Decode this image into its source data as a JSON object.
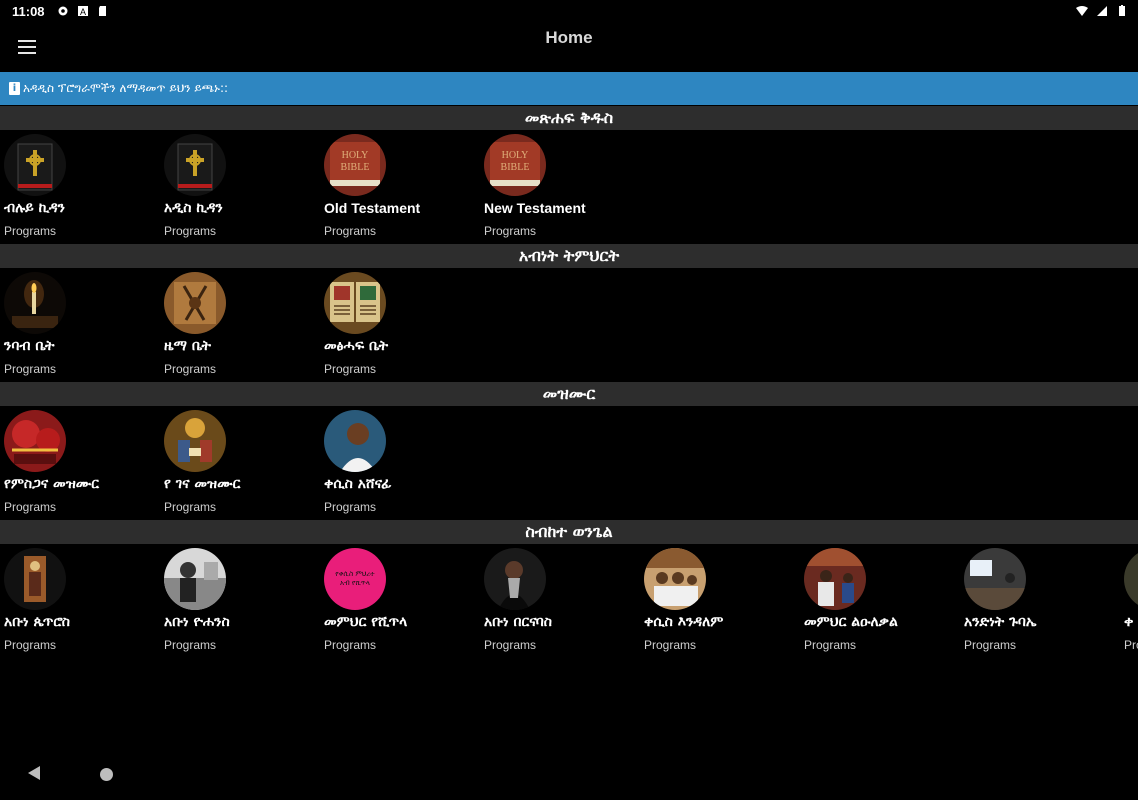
{
  "status_bar": {
    "time": "11:08",
    "left_icons": [
      "gear-icon",
      "a-icon",
      "sd-card-icon"
    ],
    "right_icons": [
      "wifi-icon",
      "signal-icon",
      "battery-icon"
    ]
  },
  "app_bar": {
    "title": "Home",
    "menu_icon": "hamburger-icon"
  },
  "banner": {
    "icon": "info-icon",
    "text": "አዳዲስ ፕሮግራሞችን ለማዳመጥ ይህን ይጫኑ::"
  },
  "sections": [
    {
      "title": "መጽሐፍ ቅዱስ",
      "items": [
        {
          "title": "ብሉይ ኪዳን",
          "subtitle": "Programs",
          "thumb": "cross-book"
        },
        {
          "title": "አዲስ ኪዳን",
          "subtitle": "Programs",
          "thumb": "cross-book"
        },
        {
          "title": "Old Testament",
          "subtitle": "Programs",
          "thumb": "holy-bible"
        },
        {
          "title": "New Testament",
          "subtitle": "Programs",
          "thumb": "holy-bible"
        }
      ]
    },
    {
      "title": "አብነት ትምህርት",
      "items": [
        {
          "title": "ንባብ ቤት",
          "subtitle": "Programs",
          "thumb": "candle"
        },
        {
          "title": "ዜማ ቤት",
          "subtitle": "Programs",
          "thumb": "drum"
        },
        {
          "title": "መፅሓፍ ቤት",
          "subtitle": "Programs",
          "thumb": "manuscript"
        }
      ]
    },
    {
      "title": "መዝሙር",
      "items": [
        {
          "title": "የምስጋና መዝሙር",
          "subtitle": "Programs",
          "thumb": "red-umbrella"
        },
        {
          "title": "የ ገና መዝሙር",
          "subtitle": "Programs",
          "thumb": "nativity"
        },
        {
          "title": "ቀሲስ አሸናፊ",
          "subtitle": "Programs",
          "thumb": "portrait"
        }
      ]
    },
    {
      "title": "ስብከተ ወንጌል",
      "items": [
        {
          "title": "አቡነ ጴጥሮስ",
          "subtitle": "Programs",
          "thumb": "icon-painting"
        },
        {
          "title": "አቡነ ዮሐንስ",
          "subtitle": "Programs",
          "thumb": "bw-photo"
        },
        {
          "title": "መምህር የሺጥላ",
          "subtitle": "Programs",
          "thumb": "pink-text",
          "thumb_text": "የቀሲስ ምህረተ አብ የሺጥላ"
        },
        {
          "title": "አቡነ በርናባስ",
          "subtitle": "Programs",
          "thumb": "bishop"
        },
        {
          "title": "ቀሲስ እንዳለም",
          "subtitle": "Programs",
          "thumb": "group-photo"
        },
        {
          "title": "መምህር ልዑለቃል",
          "subtitle": "Programs",
          "thumb": "preacher"
        },
        {
          "title": "አንድነት ጉባኤ",
          "subtitle": "Programs",
          "thumb": "hall"
        },
        {
          "title": "ቀ",
          "subtitle": "Programs",
          "thumb": "partial"
        }
      ]
    }
  ],
  "nav_bar": {
    "back_icon": "back-triangle-icon",
    "home_icon": "home-circle-icon"
  }
}
